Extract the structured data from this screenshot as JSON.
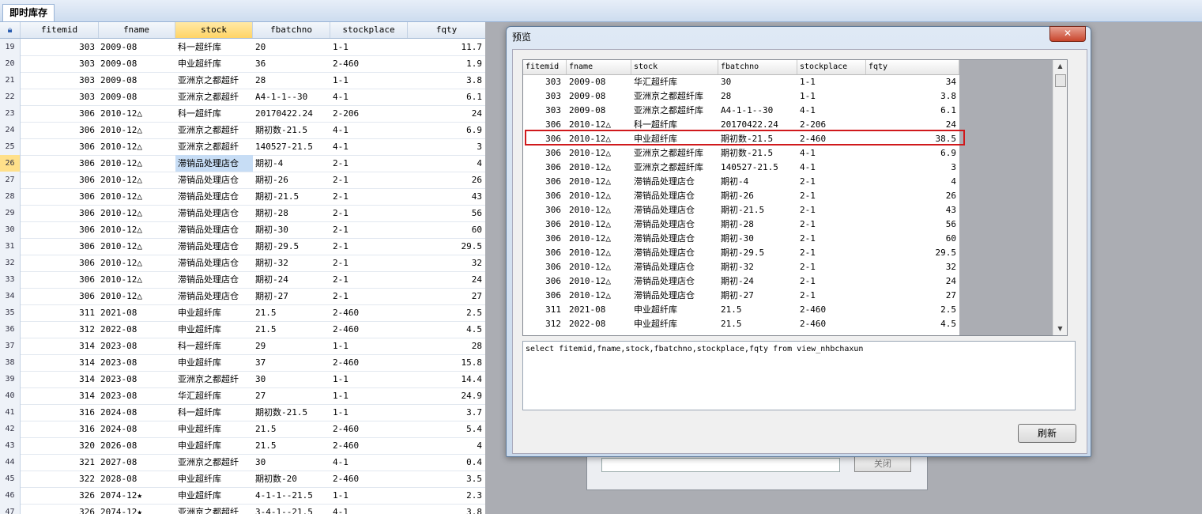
{
  "tab_label": "即时库存",
  "grid": {
    "columns": [
      "fitemid",
      "fname",
      "stock",
      "fbatchno",
      "stockplace",
      "fqty"
    ],
    "rows": [
      {
        "n": "19",
        "fitemid": "303",
        "fname": "2009-08",
        "stock": "科一超纤库",
        "fbatchno": "20",
        "stockplace": "1-1",
        "fqty": "11.7"
      },
      {
        "n": "20",
        "fitemid": "303",
        "fname": "2009-08",
        "stock": "申业超纤库",
        "fbatchno": "36",
        "stockplace": "2-460",
        "fqty": "1.9"
      },
      {
        "n": "21",
        "fitemid": "303",
        "fname": "2009-08",
        "stock": "亚洲京之都超纤",
        "fbatchno": "28",
        "stockplace": "1-1",
        "fqty": "3.8"
      },
      {
        "n": "22",
        "fitemid": "303",
        "fname": "2009-08",
        "stock": "亚洲京之都超纤",
        "fbatchno": "A4-1-1--30",
        "stockplace": "4-1",
        "fqty": "6.1"
      },
      {
        "n": "23",
        "fitemid": "306",
        "fname": "2010-12△",
        "stock": "科一超纤库",
        "fbatchno": "20170422.24",
        "stockplace": "2-206",
        "fqty": "24"
      },
      {
        "n": "24",
        "fitemid": "306",
        "fname": "2010-12△",
        "stock": "亚洲京之都超纤",
        "fbatchno": "期初数-21.5",
        "stockplace": "4-1",
        "fqty": "6.9"
      },
      {
        "n": "25",
        "fitemid": "306",
        "fname": "2010-12△",
        "stock": "亚洲京之都超纤",
        "fbatchno": "140527-21.5",
        "stockplace": "4-1",
        "fqty": "3"
      },
      {
        "n": "26",
        "fitemid": "306",
        "fname": "2010-12△",
        "stock": "滞销品处理店仓",
        "fbatchno": "期初-4",
        "stockplace": "2-1",
        "fqty": "4"
      },
      {
        "n": "27",
        "fitemid": "306",
        "fname": "2010-12△",
        "stock": "滞销品处理店仓",
        "fbatchno": "期初-26",
        "stockplace": "2-1",
        "fqty": "26"
      },
      {
        "n": "28",
        "fitemid": "306",
        "fname": "2010-12△",
        "stock": "滞销品处理店仓",
        "fbatchno": "期初-21.5",
        "stockplace": "2-1",
        "fqty": "43"
      },
      {
        "n": "29",
        "fitemid": "306",
        "fname": "2010-12△",
        "stock": "滞销品处理店仓",
        "fbatchno": "期初-28",
        "stockplace": "2-1",
        "fqty": "56"
      },
      {
        "n": "30",
        "fitemid": "306",
        "fname": "2010-12△",
        "stock": "滞销品处理店仓",
        "fbatchno": "期初-30",
        "stockplace": "2-1",
        "fqty": "60"
      },
      {
        "n": "31",
        "fitemid": "306",
        "fname": "2010-12△",
        "stock": "滞销品处理店仓",
        "fbatchno": "期初-29.5",
        "stockplace": "2-1",
        "fqty": "29.5"
      },
      {
        "n": "32",
        "fitemid": "306",
        "fname": "2010-12△",
        "stock": "滞销品处理店仓",
        "fbatchno": "期初-32",
        "stockplace": "2-1",
        "fqty": "32"
      },
      {
        "n": "33",
        "fitemid": "306",
        "fname": "2010-12△",
        "stock": "滞销品处理店仓",
        "fbatchno": "期初-24",
        "stockplace": "2-1",
        "fqty": "24"
      },
      {
        "n": "34",
        "fitemid": "306",
        "fname": "2010-12△",
        "stock": "滞销品处理店仓",
        "fbatchno": "期初-27",
        "stockplace": "2-1",
        "fqty": "27"
      },
      {
        "n": "35",
        "fitemid": "311",
        "fname": "2021-08",
        "stock": "申业超纤库",
        "fbatchno": "21.5",
        "stockplace": "2-460",
        "fqty": "2.5"
      },
      {
        "n": "36",
        "fitemid": "312",
        "fname": "2022-08",
        "stock": "申业超纤库",
        "fbatchno": "21.5",
        "stockplace": "2-460",
        "fqty": "4.5"
      },
      {
        "n": "37",
        "fitemid": "314",
        "fname": "2023-08",
        "stock": "科一超纤库",
        "fbatchno": "29",
        "stockplace": "1-1",
        "fqty": "28"
      },
      {
        "n": "38",
        "fitemid": "314",
        "fname": "2023-08",
        "stock": "申业超纤库",
        "fbatchno": "37",
        "stockplace": "2-460",
        "fqty": "15.8"
      },
      {
        "n": "39",
        "fitemid": "314",
        "fname": "2023-08",
        "stock": "亚洲京之都超纤",
        "fbatchno": "30",
        "stockplace": "1-1",
        "fqty": "14.4"
      },
      {
        "n": "40",
        "fitemid": "314",
        "fname": "2023-08",
        "stock": "华汇超纤库",
        "fbatchno": "27",
        "stockplace": "1-1",
        "fqty": "24.9"
      },
      {
        "n": "41",
        "fitemid": "316",
        "fname": "2024-08",
        "stock": "科一超纤库",
        "fbatchno": "期初数-21.5",
        "stockplace": "1-1",
        "fqty": "3.7"
      },
      {
        "n": "42",
        "fitemid": "316",
        "fname": "2024-08",
        "stock": "申业超纤库",
        "fbatchno": "21.5",
        "stockplace": "2-460",
        "fqty": "5.4"
      },
      {
        "n": "43",
        "fitemid": "320",
        "fname": "2026-08",
        "stock": "申业超纤库",
        "fbatchno": "21.5",
        "stockplace": "2-460",
        "fqty": "4"
      },
      {
        "n": "44",
        "fitemid": "321",
        "fname": "2027-08",
        "stock": "亚洲京之都超纤",
        "fbatchno": "30",
        "stockplace": "4-1",
        "fqty": "0.4"
      },
      {
        "n": "45",
        "fitemid": "322",
        "fname": "2028-08",
        "stock": "申业超纤库",
        "fbatchno": "期初数-20",
        "stockplace": "2-460",
        "fqty": "3.5"
      },
      {
        "n": "46",
        "fitemid": "326",
        "fname": "2074-12★",
        "stock": "申业超纤库",
        "fbatchno": "4-1-1--21.5",
        "stockplace": "1-1",
        "fqty": "2.3"
      },
      {
        "n": "47",
        "fitemid": "326",
        "fname": "2074-12★",
        "stock": "亚洲京之都超纤",
        "fbatchno": "3-4-1--21.5",
        "stockplace": "4-1",
        "fqty": "3.8"
      }
    ]
  },
  "behind_dialog": {
    "button_label": "关闭"
  },
  "preview": {
    "title": "预览",
    "close_glyph": "✕",
    "columns": [
      "fitemid",
      "fname",
      "stock",
      "fbatchno",
      "stockplace",
      "fqty"
    ],
    "rows": [
      {
        "fitemid": "303",
        "fname": "2009-08",
        "stock": "华汇超纤库",
        "fbatchno": "30",
        "stockplace": "1-1",
        "fqty": "34"
      },
      {
        "fitemid": "303",
        "fname": "2009-08",
        "stock": "亚洲京之都超纤库",
        "fbatchno": "28",
        "stockplace": "1-1",
        "fqty": "3.8"
      },
      {
        "fitemid": "303",
        "fname": "2009-08",
        "stock": "亚洲京之都超纤库",
        "fbatchno": "A4-1-1--30",
        "stockplace": "4-1",
        "fqty": "6.1"
      },
      {
        "fitemid": "306",
        "fname": "2010-12△",
        "stock": "科一超纤库",
        "fbatchno": "20170422.24",
        "stockplace": "2-206",
        "fqty": "24"
      },
      {
        "fitemid": "306",
        "fname": "2010-12△",
        "stock": "申业超纤库",
        "fbatchno": "期初数-21.5",
        "stockplace": "2-460",
        "fqty": "38.5"
      },
      {
        "fitemid": "306",
        "fname": "2010-12△",
        "stock": "亚洲京之都超纤库",
        "fbatchno": "期初数-21.5",
        "stockplace": "4-1",
        "fqty": "6.9"
      },
      {
        "fitemid": "306",
        "fname": "2010-12△",
        "stock": "亚洲京之都超纤库",
        "fbatchno": "140527-21.5",
        "stockplace": "4-1",
        "fqty": "3"
      },
      {
        "fitemid": "306",
        "fname": "2010-12△",
        "stock": "滞销品处理店仓",
        "fbatchno": "期初-4",
        "stockplace": "2-1",
        "fqty": "4"
      },
      {
        "fitemid": "306",
        "fname": "2010-12△",
        "stock": "滞销品处理店仓",
        "fbatchno": "期初-26",
        "stockplace": "2-1",
        "fqty": "26"
      },
      {
        "fitemid": "306",
        "fname": "2010-12△",
        "stock": "滞销品处理店仓",
        "fbatchno": "期初-21.5",
        "stockplace": "2-1",
        "fqty": "43"
      },
      {
        "fitemid": "306",
        "fname": "2010-12△",
        "stock": "滞销品处理店仓",
        "fbatchno": "期初-28",
        "stockplace": "2-1",
        "fqty": "56"
      },
      {
        "fitemid": "306",
        "fname": "2010-12△",
        "stock": "滞销品处理店仓",
        "fbatchno": "期初-30",
        "stockplace": "2-1",
        "fqty": "60"
      },
      {
        "fitemid": "306",
        "fname": "2010-12△",
        "stock": "滞销品处理店仓",
        "fbatchno": "期初-29.5",
        "stockplace": "2-1",
        "fqty": "29.5"
      },
      {
        "fitemid": "306",
        "fname": "2010-12△",
        "stock": "滞销品处理店仓",
        "fbatchno": "期初-32",
        "stockplace": "2-1",
        "fqty": "32"
      },
      {
        "fitemid": "306",
        "fname": "2010-12△",
        "stock": "滞销品处理店仓",
        "fbatchno": "期初-24",
        "stockplace": "2-1",
        "fqty": "24"
      },
      {
        "fitemid": "306",
        "fname": "2010-12△",
        "stock": "滞销品处理店仓",
        "fbatchno": "期初-27",
        "stockplace": "2-1",
        "fqty": "27"
      },
      {
        "fitemid": "311",
        "fname": "2021-08",
        "stock": "申业超纤库",
        "fbatchno": "21.5",
        "stockplace": "2-460",
        "fqty": "2.5"
      },
      {
        "fitemid": "312",
        "fname": "2022-08",
        "stock": "申业超纤库",
        "fbatchno": "21.5",
        "stockplace": "2-460",
        "fqty": "4.5"
      }
    ],
    "sql": "select fitemid,fname,stock,fbatchno,stockplace,fqty from view_nhbchaxun",
    "refresh_label": "刷新"
  }
}
